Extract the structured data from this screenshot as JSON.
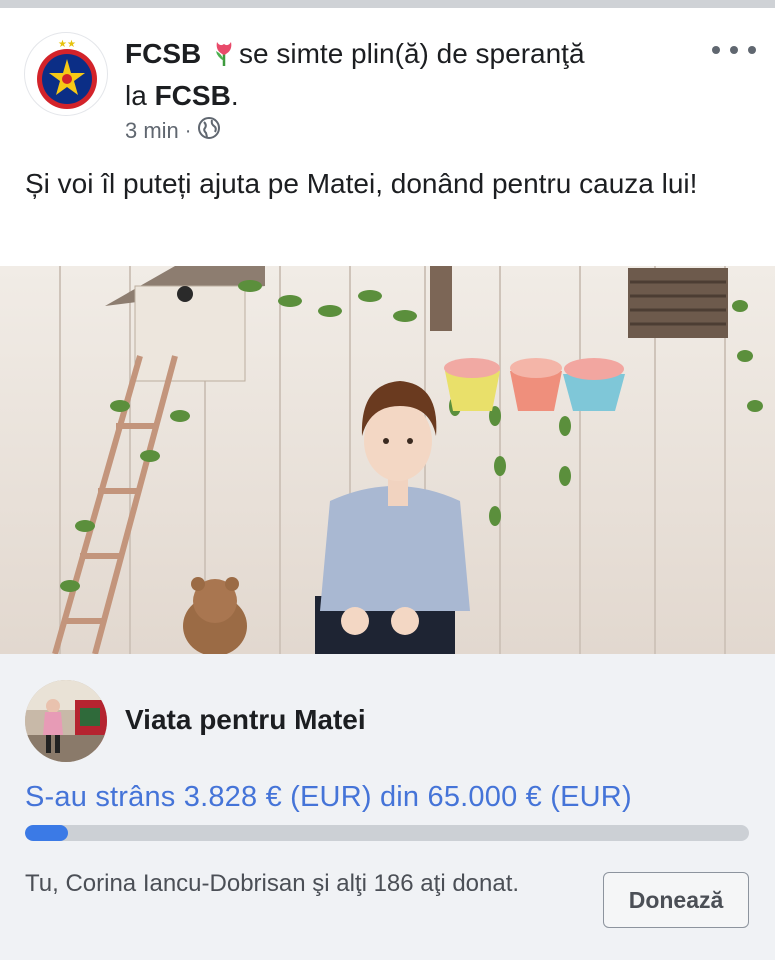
{
  "post": {
    "author": "FCSB",
    "feeling_text": "se simte plin(ă) de speranţă",
    "feeling_la": "la",
    "feeling_target": "FCSB",
    "feeling_end": ".",
    "time": "3 min",
    "separator": "·",
    "audience_icon": "globe-icon",
    "feeling_icon": "tulip-icon",
    "body": "Și voi îl puteți ajuta pe Matei, donând pentru cauza lui!"
  },
  "fundraiser": {
    "title": "Viata pentru Matei",
    "raised_text": "S-au strâns 3.828 € (EUR) din 65.000 € (EUR)",
    "progress_fraction": 0.0589,
    "donors_text": "Tu, Corina Iancu-Dobrisan şi alţi 186 aţi donat.",
    "donate_label": "Donează"
  },
  "colors": {
    "accent": "#4574d8",
    "progress_fill": "#3b7ae6",
    "panel_bg": "#f0f2f5"
  }
}
